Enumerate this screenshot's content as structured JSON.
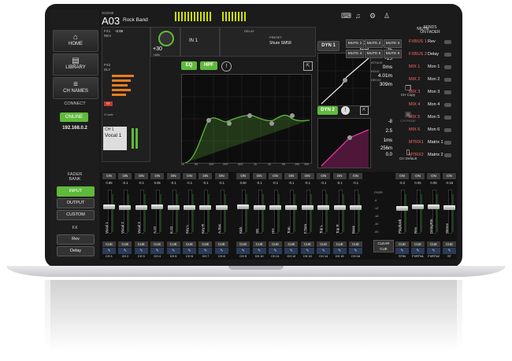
{
  "nav": {
    "home": "HOME",
    "library": "LIBRARY",
    "ch_names": "CH NAMES",
    "connect": "CONNECT",
    "online": "ONLINE",
    "ip": "192.168.0.2",
    "fader_bank": "FADER\nBANK",
    "input": "INPUT",
    "output": "OUTPUT",
    "custom": "CUSTOM",
    "fx": "FX",
    "rev": "Rev",
    "delay": "Delay"
  },
  "scene": {
    "label": "SCENE",
    "number": "A03",
    "name": "Rock Band"
  },
  "channel": {
    "fx1": "FX1",
    "fx1_name": "REV",
    "fx1_val": "-0.85",
    "fx2": "FX2",
    "fx2_name": "DLY",
    "gain": "+30",
    "phantom": "+48V",
    "in": "IN 1",
    "delay": "DELAY",
    "preset": "PRESET",
    "preset_name": "Shure SM58",
    "st": "ST",
    "ch": "CH 1",
    "ch_name": "Vocal 1",
    "g_safe": "G safe"
  },
  "eq": {
    "eq": "EQ",
    "hpf": "HPF",
    "freq_labels": [
      "20",
      "50",
      "100",
      "200",
      "500",
      "1k",
      "2k",
      "5k",
      "10k",
      "20k"
    ],
    "db_labels": [
      "+15",
      "0",
      "-15"
    ]
  },
  "dyn1": {
    "label": "DYN 1",
    "thresh_l": "THRESH",
    "thresh": "-25",
    "range_l": "RANGE",
    "range": "-15",
    "attack_l": "ATTACK",
    "attack": "0ms",
    "hold_l": "HOLD",
    "hold": "4.01m",
    "decay_l": "DECAY",
    "decay": "309m"
  },
  "dyn2": {
    "label": "DYN 2",
    "thresh": "-8",
    "ratio": "2.5",
    "attack": "1ms",
    "release": "256m",
    "gain": "0.0"
  },
  "copy": {
    "ch_copy": "CH Copy",
    "ch_paste": "CH Paste",
    "ch_default": "CH Default"
  },
  "mute": {
    "title": "MUTE",
    "buttons": [
      "MUTE 1",
      "MUTE 2",
      "MUTE 3",
      "MUTE 4",
      "MUTE 5",
      "MUTE 6"
    ]
  },
  "sends": {
    "title": "SENDS\nON FADER",
    "rows": [
      {
        "a": "FXBUS 1",
        "b": "Rev"
      },
      {
        "a": "FXBUS 2",
        "b": "Delay"
      },
      {
        "a": "MIX 1",
        "b": "Mon 1"
      },
      {
        "a": "MIX 2",
        "b": "Mon 2"
      },
      {
        "a": "MIX 3",
        "b": "Mon 3"
      },
      {
        "a": "MIX 4",
        "b": "Mon 4"
      },
      {
        "a": "MIX 5",
        "b": "Mon 5"
      },
      {
        "a": "MIX 6",
        "b": "Mon 6"
      },
      {
        "a": "MTRX1",
        "b": "Matrix 1"
      },
      {
        "a": "MTRX2",
        "b": "Matrix 2"
      }
    ]
  },
  "strips": {
    "on": "ON",
    "cue": "CUE",
    "inputs": [
      {
        "name": "Vocal 1",
        "ch": "CH 1",
        "val": "0.85",
        "level": 0.62
      },
      {
        "name": "Vocal 2",
        "ch": "CH 2",
        "val": "-0.1",
        "level": 0.6
      },
      {
        "name": "Vocal 3",
        "ch": "CH 3",
        "val": "-0.1",
        "level": 0.6
      },
      {
        "name": "A.Gt",
        "ch": "CH 4",
        "val": "0.05",
        "level": 0.62
      },
      {
        "name": "E.Gt",
        "ch": "CH 5",
        "val": "-0.1",
        "level": 0.6
      },
      {
        "name": "Key L",
        "ch": "CH 6",
        "val": "-0.1",
        "level": 0.6
      },
      {
        "name": "Key R",
        "ch": "CH 7",
        "val": "-0.1",
        "level": 0.6
      },
      {
        "name": "A.Sax",
        "ch": "CH 8",
        "val": "-0.1",
        "level": 0.6
      },
      {
        "name": "Kick",
        "ch": "CH 9",
        "val": "0.00",
        "level": 0.62
      },
      {
        "name": "SN",
        "ch": "CH 10",
        "val": "-0.1",
        "level": 0.6
      },
      {
        "name": "HH",
        "ch": "CH 11",
        "val": "-0.1",
        "level": 0.6
      },
      {
        "name": "Tom",
        "ch": "CH 12",
        "val": "-0.1",
        "level": 0.6
      },
      {
        "name": "F.Tom",
        "ch": "CH 13",
        "val": "-0.1",
        "level": 0.6
      },
      {
        "name": "Top L",
        "ch": "CH 14",
        "val": "-0.1",
        "level": 0.6
      },
      {
        "name": "Top R",
        "ch": "CH 15",
        "val": "-0.1",
        "level": 0.6
      },
      {
        "name": "Bass",
        "ch": "CH 16",
        "val": "-0.1",
        "level": 0.6
      }
    ],
    "outputs": [
      {
        "name": "Playback",
        "ch": "STIN",
        "val": "-0.2",
        "level": 0.58
      },
      {
        "name": "Rev",
        "ch": "FXRTN1",
        "val": "0.05",
        "level": 0.62
      },
      {
        "name": "DelayRtn",
        "ch": "FXRTN2",
        "val": "0.05",
        "level": 0.62
      },
      {
        "name": "Stereo",
        "ch": "ST",
        "val": "-0.15",
        "level": 0.6
      }
    ],
    "clear_cue": "CLEAR\nCUE",
    "scale": [
      "OVER",
      "-6",
      "-12",
      "-18",
      "-30",
      "-60"
    ]
  }
}
